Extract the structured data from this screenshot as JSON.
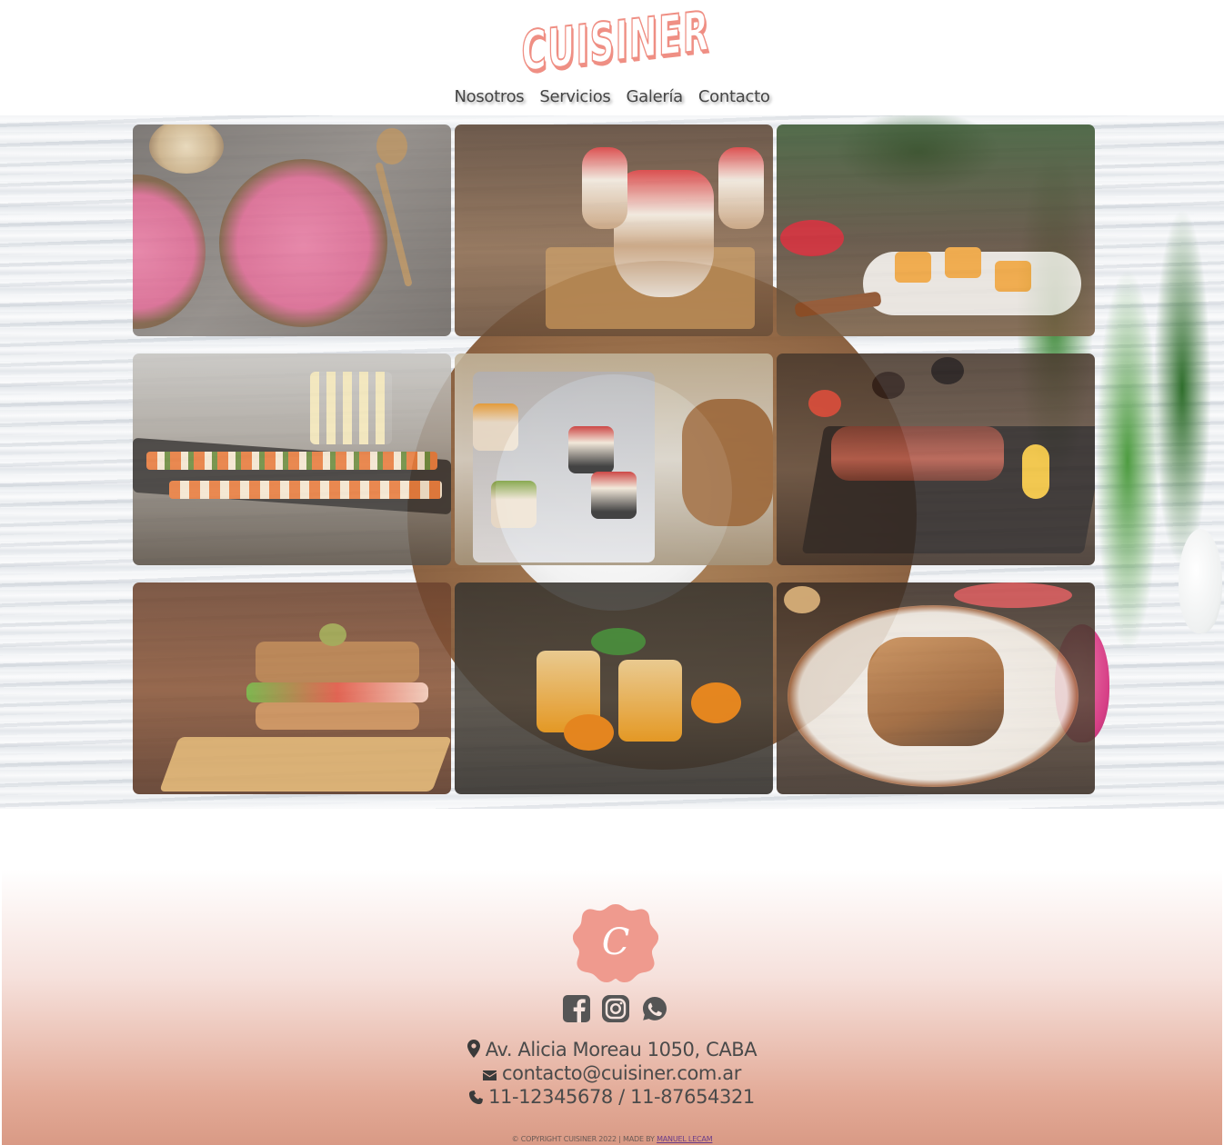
{
  "header": {
    "logo_text": "CUISINER",
    "nav": [
      {
        "label": "Nosotros"
      },
      {
        "label": "Servicios"
      },
      {
        "label": "Galería"
      },
      {
        "label": "Contacto"
      }
    ]
  },
  "gallery": {
    "images": [
      {
        "name": "raspberry-smoothie-bowls"
      },
      {
        "name": "strawberry-parfait-cups"
      },
      {
        "name": "fruit-tartlets-spoons"
      },
      {
        "name": "catering-canapes-champagne"
      },
      {
        "name": "mini-fruit-cakes"
      },
      {
        "name": "grilled-steak-board"
      },
      {
        "name": "club-sandwich"
      },
      {
        "name": "orange-mint-drinks"
      },
      {
        "name": "crepes-chocolate-plate"
      }
    ]
  },
  "footer": {
    "badge_letter": "C",
    "social": [
      "facebook-icon",
      "instagram-icon",
      "whatsapp-icon"
    ],
    "address": "Av. Alicia Moreau 1050, CABA",
    "email": "contacto@cuisiner.com.ar",
    "phone": "11-12345678 / 11-87654321",
    "copyright_prefix": "© COPYRIGHT CUISINER 2022 | MADE BY",
    "author_link": "MANUEL LECAM"
  },
  "colors": {
    "brand_salmon": "#ef8f84",
    "text_dark": "#444444",
    "footer_gradient_end": "#d99a85"
  }
}
